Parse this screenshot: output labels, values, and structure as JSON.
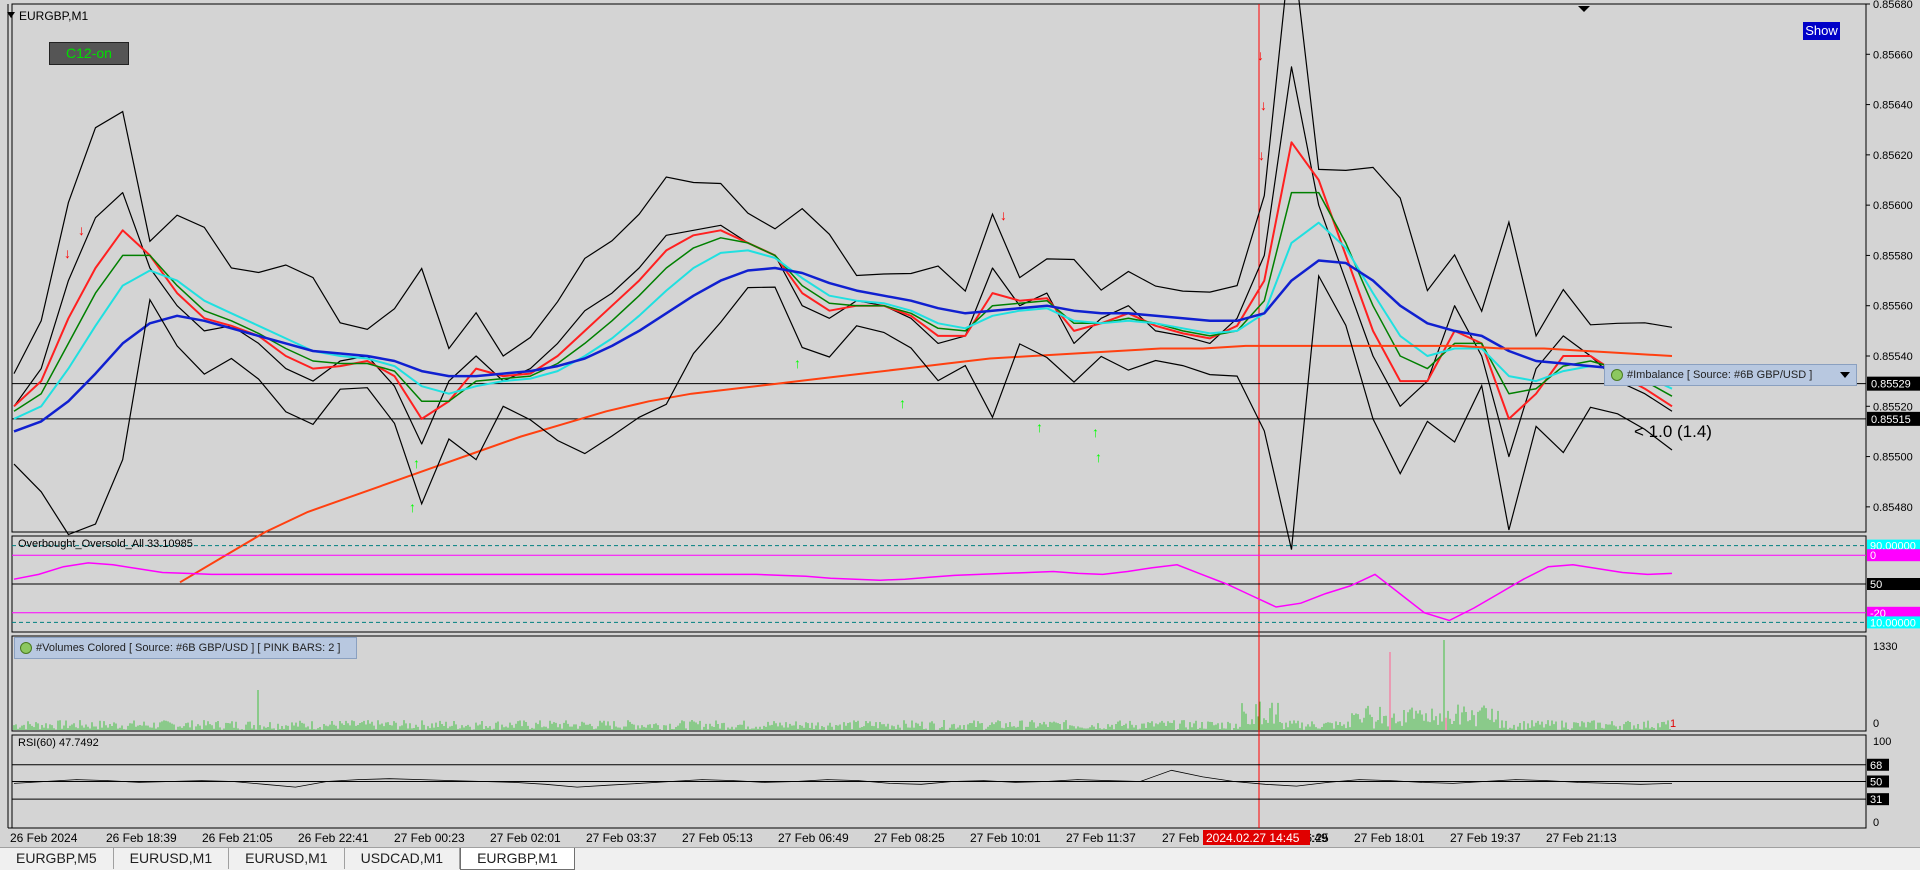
{
  "window": {
    "symbol_title": "EURGBP,M1",
    "show_button": "Show",
    "c12_button": "C12-on",
    "time_highlight": "2024.02.27 14:45"
  },
  "tabs": [
    {
      "label": "EURGBP,M5",
      "active": false
    },
    {
      "label": "EURUSD,M1",
      "active": false
    },
    {
      "label": "EURUSD,M1",
      "active": false
    },
    {
      "label": "USDCAD,M1",
      "active": false
    },
    {
      "label": "EURGBP,M1",
      "active": true
    }
  ],
  "colors": {
    "background": "#d4d4d4",
    "price": "#000000",
    "bollinger": "#000000",
    "ma_fast": "#ff2020",
    "ma_mid": "#008000",
    "ma_cyan": "#20e0e0",
    "ma_blue": "#1020d0",
    "ma_long": "#ff4010",
    "overbought_line": "#ff00ff",
    "volume": "#40c040",
    "rsi": "#000000",
    "arrow_up": "#00ff00",
    "arrow_down": "#ff0000",
    "current_time_line": "#ff0000"
  },
  "overlays": {
    "imbalance_label": "#Imbalance [ Source: #6B GBP/USD ]",
    "ratio_label": "< 1.0 (1.4)",
    "volumes_label": "#Volumes Colored [ Source: #6B GBP/USD ]  [ PINK BARS: 2 ]",
    "volume_pink_count": "1"
  },
  "chart_data": [
    {
      "type": "line",
      "panel": "main",
      "title": "EURGBP,M1",
      "ylim": [
        0.8547,
        0.8568
      ],
      "y_ticks": [
        "0.85680",
        "0.85660",
        "0.85640",
        "0.85620",
        "0.85600",
        "0.85580",
        "0.85560",
        "0.85540",
        "0.85520",
        "0.85500",
        "0.85480"
      ],
      "price_markers": [
        "0.85529",
        "0.85515"
      ],
      "x_ticks": [
        "26 Feb 2024",
        "26 Feb 18:39",
        "26 Feb 21:05",
        "26 Feb 22:41",
        "27 Feb 00:23",
        "27 Feb 02:01",
        "27 Feb 03:37",
        "27 Feb 05:13",
        "27 Feb 06:49",
        "27 Feb 08:25",
        "27 Feb 10:01",
        "27 Feb 11:37",
        "27 Feb",
        "27 Feb 16:25",
        "27 Feb 18:01",
        "27 Feb 19:37",
        "27 Feb 21:13"
      ],
      "x_tick_partial": ":49",
      "series": [
        {
          "values": [
            0.8552,
            0.85535,
            0.8557,
            0.85595,
            0.85605,
            0.85575,
            0.8556,
            0.8555,
            0.85552,
            0.85545,
            0.85535,
            0.8553,
            0.85538,
            0.8554,
            0.85528,
            0.85505,
            0.8553,
            0.8554,
            0.8553,
            0.85535,
            0.85545,
            0.85558,
            0.85565,
            0.85575,
            0.85588,
            0.8559,
            0.85592,
            0.85585,
            0.8558,
            0.8556,
            0.85555,
            0.85562,
            0.8556,
            0.85555,
            0.85545,
            0.85548,
            0.85575,
            0.8556,
            0.85565,
            0.85545,
            0.85555,
            0.8556,
            0.8555,
            0.85548,
            0.85545,
            0.85555,
            0.8558,
            0.85655,
            0.856,
            0.8557,
            0.8554,
            0.8552,
            0.8553,
            0.8556,
            0.8554,
            0.855,
            0.85535,
            0.85548,
            0.8554,
            0.8553,
            0.85525,
            0.85518
          ]
        },
        {
          "values": [
            0.8552,
            0.8553,
            0.85555,
            0.85575,
            0.8559,
            0.8558,
            0.85565,
            0.85555,
            0.85552,
            0.85548,
            0.8554,
            0.85535,
            0.85536,
            0.85538,
            0.85532,
            0.85515,
            0.85522,
            0.85535,
            0.85532,
            0.85533,
            0.8554,
            0.8555,
            0.8556,
            0.8557,
            0.85582,
            0.85588,
            0.8559,
            0.85585,
            0.8558,
            0.85565,
            0.85558,
            0.8556,
            0.8556,
            0.85556,
            0.85548,
            0.85548,
            0.85565,
            0.85562,
            0.85563,
            0.8555,
            0.85553,
            0.85557,
            0.85552,
            0.85549,
            0.85547,
            0.85552,
            0.8557,
            0.85625,
            0.8561,
            0.8558,
            0.8555,
            0.8553,
            0.8553,
            0.8555,
            0.85545,
            0.85515,
            0.85525,
            0.8554,
            0.8554,
            0.85533,
            0.85527,
            0.8552
          ]
        },
        {
          "values": [
            0.85518,
            0.85525,
            0.85545,
            0.85565,
            0.8558,
            0.8558,
            0.85568,
            0.85558,
            0.85554,
            0.85549,
            0.85543,
            0.85538,
            0.85537,
            0.85537,
            0.85534,
            0.85522,
            0.85522,
            0.8553,
            0.85531,
            0.85532,
            0.85537,
            0.85545,
            0.85554,
            0.85564,
            0.85575,
            0.85583,
            0.85587,
            0.85585,
            0.8558,
            0.85568,
            0.85561,
            0.8556,
            0.8556,
            0.85557,
            0.85551,
            0.8555,
            0.8556,
            0.85561,
            0.85562,
            0.85553,
            0.85553,
            0.85555,
            0.85553,
            0.8555,
            0.85548,
            0.8555,
            0.85562,
            0.85605,
            0.85605,
            0.85585,
            0.8556,
            0.8554,
            0.85535,
            0.85545,
            0.85545,
            0.85525,
            0.85527,
            0.85536,
            0.85538,
            0.85535,
            0.8553,
            0.85524
          ]
        },
        {
          "values": [
            0.85515,
            0.8552,
            0.85535,
            0.85552,
            0.85568,
            0.85574,
            0.8557,
            0.85562,
            0.85557,
            0.85552,
            0.85547,
            0.85542,
            0.8554,
            0.85539,
            0.85536,
            0.85528,
            0.85525,
            0.85528,
            0.8553,
            0.85531,
            0.85534,
            0.8554,
            0.85547,
            0.85556,
            0.85566,
            0.85575,
            0.85581,
            0.85582,
            0.85579,
            0.85571,
            0.85564,
            0.85562,
            0.85561,
            0.85558,
            0.85553,
            0.85551,
            0.85556,
            0.85558,
            0.85559,
            0.85554,
            0.85553,
            0.85554,
            0.85553,
            0.85551,
            0.85549,
            0.8555,
            0.85557,
            0.85585,
            0.85593,
            0.85583,
            0.85565,
            0.85548,
            0.8554,
            0.85543,
            0.85543,
            0.85532,
            0.8553,
            0.85534,
            0.85536,
            0.85535,
            0.85532,
            0.85527
          ]
        },
        {
          "values": [
            0.8551,
            0.85514,
            0.85522,
            0.85533,
            0.85545,
            0.85553,
            0.85556,
            0.85554,
            0.85551,
            0.85548,
            0.85545,
            0.85542,
            0.85541,
            0.8554,
            0.85538,
            0.85534,
            0.85532,
            0.85532,
            0.85533,
            0.85534,
            0.85536,
            0.85539,
            0.85544,
            0.8555,
            0.85557,
            0.85564,
            0.8557,
            0.85574,
            0.85575,
            0.85573,
            0.85569,
            0.85566,
            0.85564,
            0.85562,
            0.85559,
            0.85557,
            0.85558,
            0.85559,
            0.8556,
            0.85558,
            0.85557,
            0.85557,
            0.85556,
            0.85555,
            0.85554,
            0.85554,
            0.85557,
            0.8557,
            0.85578,
            0.85577,
            0.8557,
            0.8556,
            0.85553,
            0.8555,
            0.85548,
            0.85542,
            0.85538,
            0.85537,
            0.85536,
            0.85535,
            0.85533,
            0.8553
          ]
        },
        {
          "values": [
            0.8545,
            0.8546,
            0.8547,
            0.85478,
            0.85484,
            0.8549,
            0.85496,
            0.85502,
            0.85508,
            0.85513,
            0.85518,
            0.85522,
            0.85525,
            0.85527,
            0.85529,
            0.85531,
            0.85533,
            0.85535,
            0.85537,
            0.85539,
            0.8554,
            0.85541,
            0.85542,
            0.85543,
            0.85543,
            0.85544,
            0.85544,
            0.85544,
            0.85544,
            0.85544,
            0.85544,
            0.85543,
            0.85543,
            0.85542,
            0.85541,
            0.8554
          ]
        }
      ]
    },
    {
      "type": "line",
      "panel": "overbought_oversold",
      "title": "Overbought_Oversold_All 33.10985",
      "levels": [
        "90.00000",
        "0",
        "50",
        "-20",
        "10.00000"
      ],
      "ylim": [
        0,
        100
      ],
      "series": [
        {
          "values": [
            55,
            60,
            68,
            72,
            70,
            66,
            62,
            61,
            60,
            60,
            60,
            60,
            60,
            60,
            60,
            60,
            60,
            60,
            60,
            60,
            60,
            60,
            60,
            60,
            60,
            60,
            60,
            60,
            60,
            60,
            60,
            59,
            58,
            56,
            55,
            54,
            55,
            57,
            59,
            60,
            61,
            62,
            63,
            61,
            60,
            63,
            67,
            70,
            60,
            50,
            38,
            26,
            30,
            40,
            48,
            60,
            40,
            20,
            12,
            25,
            40,
            55,
            68,
            70,
            66,
            62,
            60,
            61
          ]
        }
      ]
    },
    {
      "type": "bar",
      "panel": "volumes",
      "title": "#Volumes Colored",
      "y_ticks": [
        "1330",
        "0"
      ],
      "ylim": [
        0,
        1330
      ],
      "pink_bars": 2
    },
    {
      "type": "line",
      "panel": "rsi",
      "title": "RSI(60) 47.7492",
      "y_ticks": [
        "100",
        "68",
        "50",
        "31",
        "0"
      ],
      "ylim": [
        0,
        100
      ],
      "series": [
        {
          "values": [
            48,
            50,
            52,
            51,
            49,
            50,
            51,
            50,
            47,
            44,
            50,
            52,
            53,
            52,
            51,
            50,
            49,
            47,
            44,
            46,
            48,
            50,
            52,
            51,
            49,
            50,
            52,
            51,
            48,
            47,
            50,
            51,
            49,
            50,
            52,
            51,
            50,
            62,
            55,
            50,
            47,
            45,
            49,
            52,
            51,
            49,
            48,
            50,
            52,
            51,
            49,
            48,
            47,
            48
          ]
        }
      ]
    }
  ]
}
